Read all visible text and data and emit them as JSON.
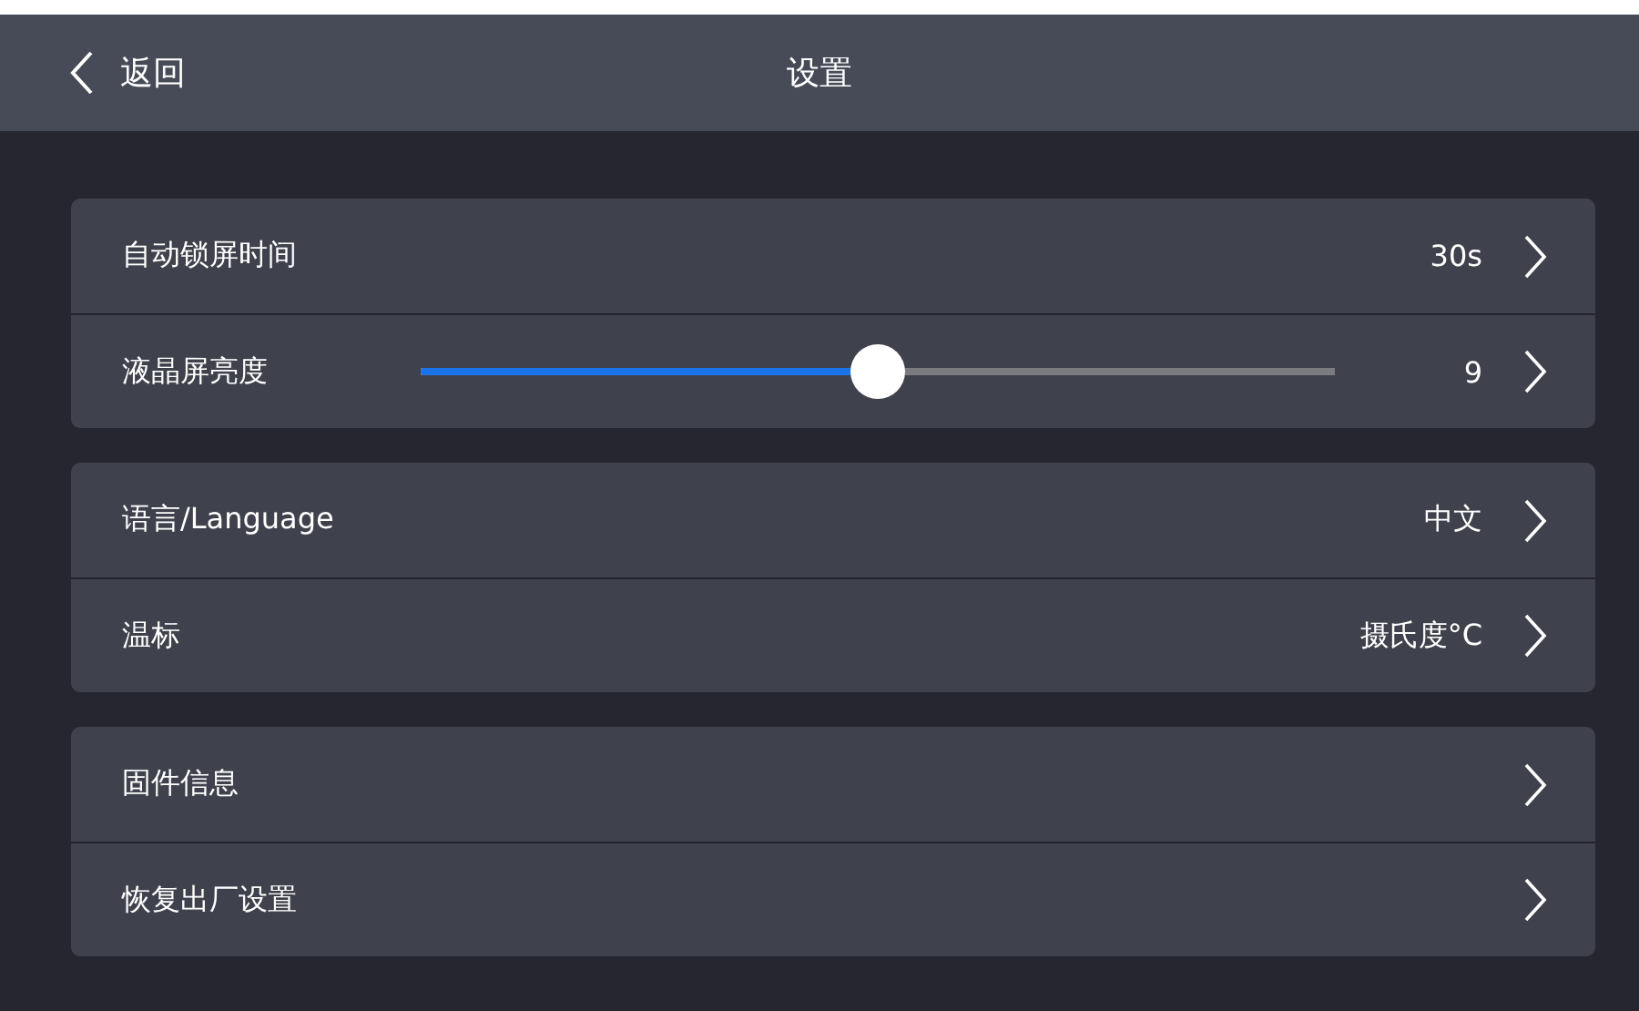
{
  "header": {
    "back_icon_label": "返回",
    "title": "设置"
  },
  "groups": [
    {
      "rows": [
        {
          "kind": "value",
          "label": "自动锁屏时间",
          "value": "30s"
        },
        {
          "kind": "slider",
          "label": "液晶屏亮度",
          "level": 0.5,
          "value": "9"
        }
      ]
    },
    {
      "rows": [
        {
          "kind": "value",
          "label": "语言/Language",
          "value": "中文"
        },
        {
          "kind": "value",
          "label": "温标",
          "value": "摄氏度°C"
        }
      ]
    },
    {
      "rows": [
        {
          "kind": "value",
          "label": "固件信息"
        },
        {
          "kind": "value",
          "label": "恢复出厂设置"
        }
      ]
    }
  ]
}
